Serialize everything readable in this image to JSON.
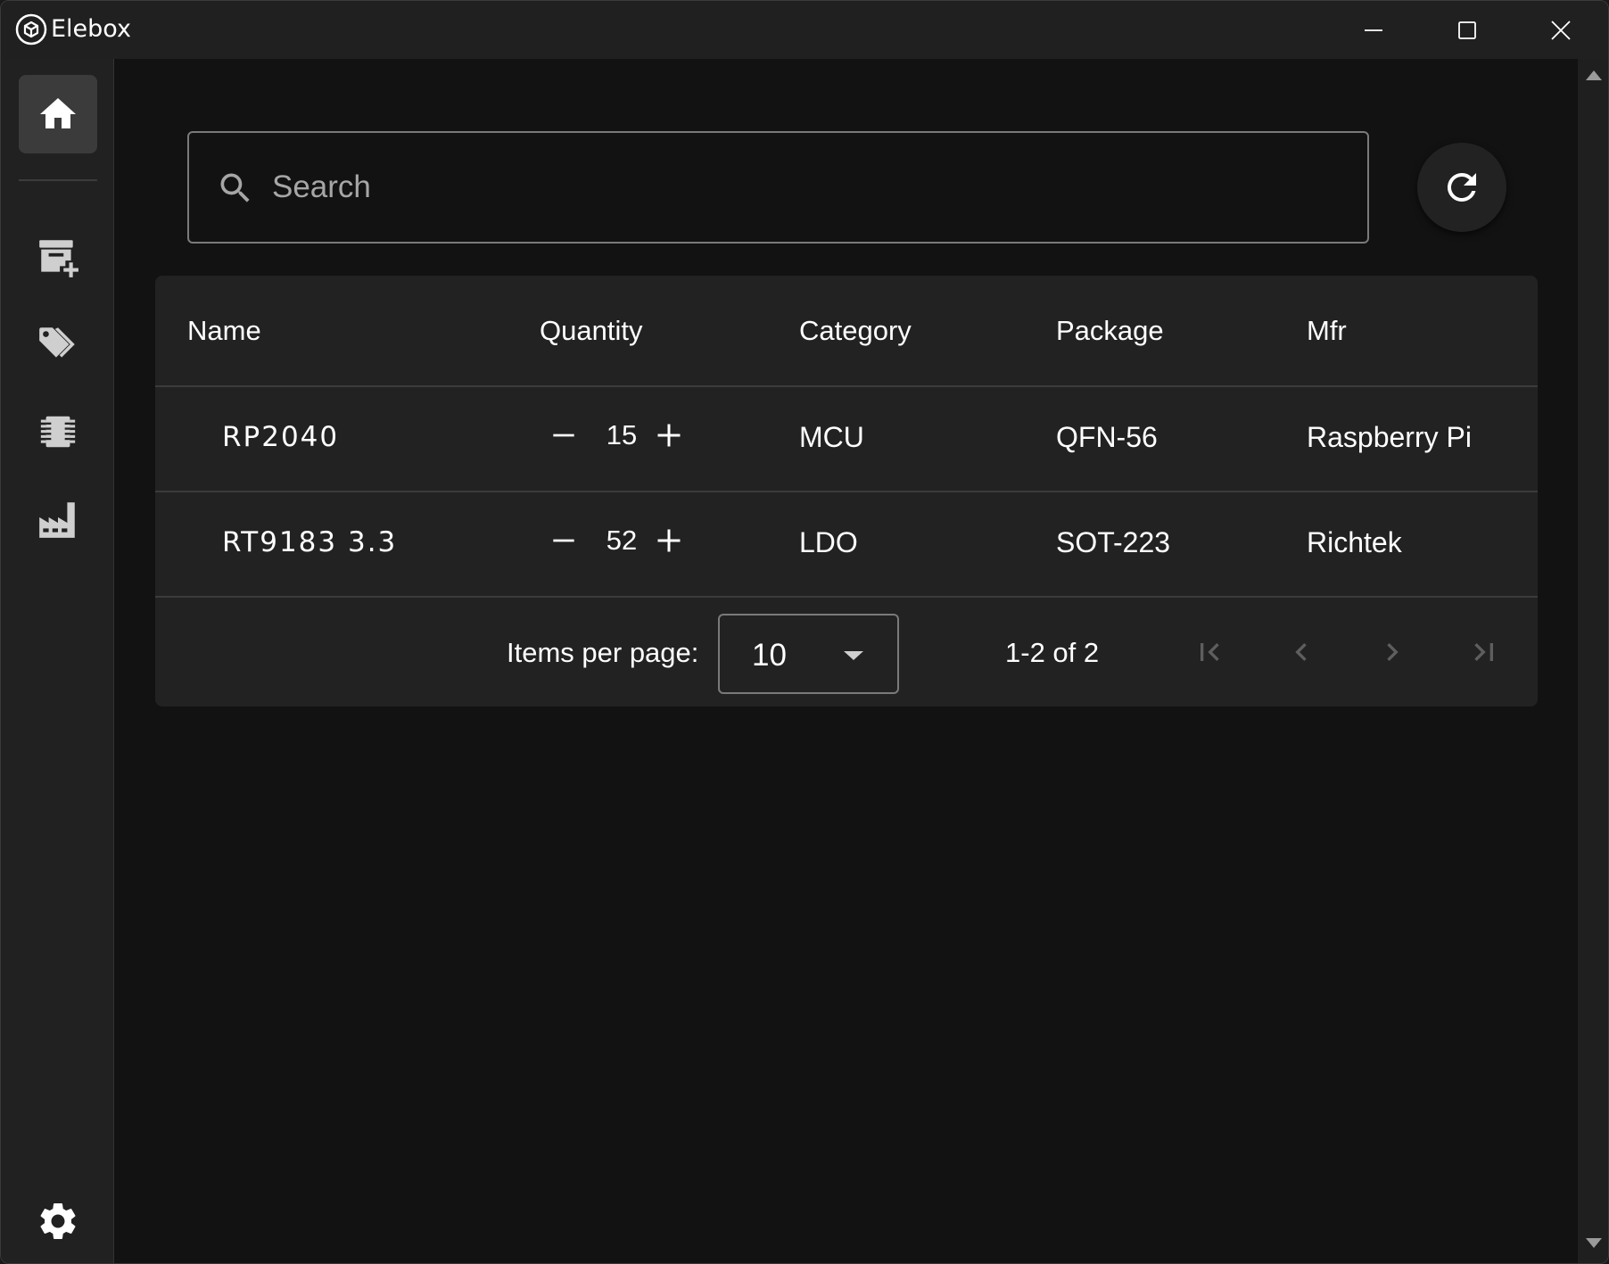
{
  "window": {
    "title": "Elebox",
    "logo_icon": "elebox-logo-icon",
    "controls": [
      "minimize-icon",
      "maximize-icon",
      "close-icon"
    ]
  },
  "sidebar": {
    "items": [
      {
        "name": "home",
        "icon": "home-icon",
        "active": true
      },
      {
        "name": "add-part",
        "icon": "archive-plus-icon",
        "active": false
      },
      {
        "name": "categories",
        "icon": "tags-icon",
        "active": false
      },
      {
        "name": "packages",
        "icon": "chip-icon",
        "active": false
      },
      {
        "name": "manufacturers",
        "icon": "factory-icon",
        "active": false
      }
    ],
    "footer": {
      "name": "settings",
      "icon": "gear-icon"
    }
  },
  "search": {
    "placeholder": "Search",
    "value": "",
    "icon": "search-icon"
  },
  "refresh": {
    "icon": "refresh-icon"
  },
  "table": {
    "columns": [
      "Name",
      "Quantity",
      "Category",
      "Package",
      "Mfr"
    ],
    "rows": [
      {
        "name": "RP2040",
        "quantity": "15",
        "category": "MCU",
        "package": "QFN-56",
        "mfr": "Raspberry Pi"
      },
      {
        "name": "RT9183 3.3",
        "quantity": "52",
        "category": "LDO",
        "package": "SOT-223",
        "mfr": "Richtek"
      }
    ]
  },
  "pagination": {
    "items_per_page_label": "Items per page:",
    "items_per_page_value": "10",
    "range_label": "1-2 of 2"
  },
  "colors": {
    "background": "#121212",
    "surface": "#222222",
    "sidebar": "#212121",
    "active_nav": "#3b3b3b",
    "text": "#ffffff",
    "muted_icon": "#5e5e5e"
  }
}
